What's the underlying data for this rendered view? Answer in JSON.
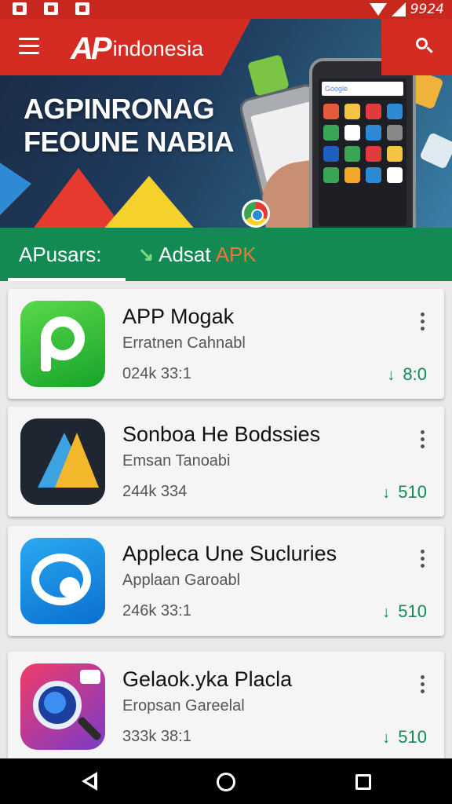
{
  "status_bar": {
    "time": "9924"
  },
  "header": {
    "logo_mark": "AP",
    "logo_text": "indonesia",
    "headline_line1": "AGPINRONAG",
    "headline_line2": "FEOUNE NABIA",
    "phone_search_text": "Google"
  },
  "tabs": [
    {
      "label": "APusars:"
    },
    {
      "label": "Adsat",
      "suffix": "APK"
    }
  ],
  "apps": [
    {
      "title": "APP Mogak",
      "developer": "Erratnen Cahnabl",
      "meta": "024k 33:1",
      "rating": "8:0",
      "icon": "green-app-icon"
    },
    {
      "title": "Sonboa He Bodssies",
      "developer": "Emsan Tanoabi",
      "meta": "244k 334",
      "rating": "510",
      "icon": "arrow-app-icon"
    },
    {
      "title": "Appleca Une Sucluries",
      "developer": "Applaan Garoabl",
      "meta": "246k 33:1",
      "rating": "510",
      "icon": "chat-app-icon"
    },
    {
      "title": "Gelaok.yka Placla",
      "developer": "Eropsan Gareelal",
      "meta": "333k 38:1",
      "rating": "510",
      "icon": "camera-app-icon"
    }
  ],
  "colors": {
    "status": "#c9281f",
    "tabs": "#138a52",
    "accent_green": "#138a52",
    "apk": "#e8783a"
  }
}
